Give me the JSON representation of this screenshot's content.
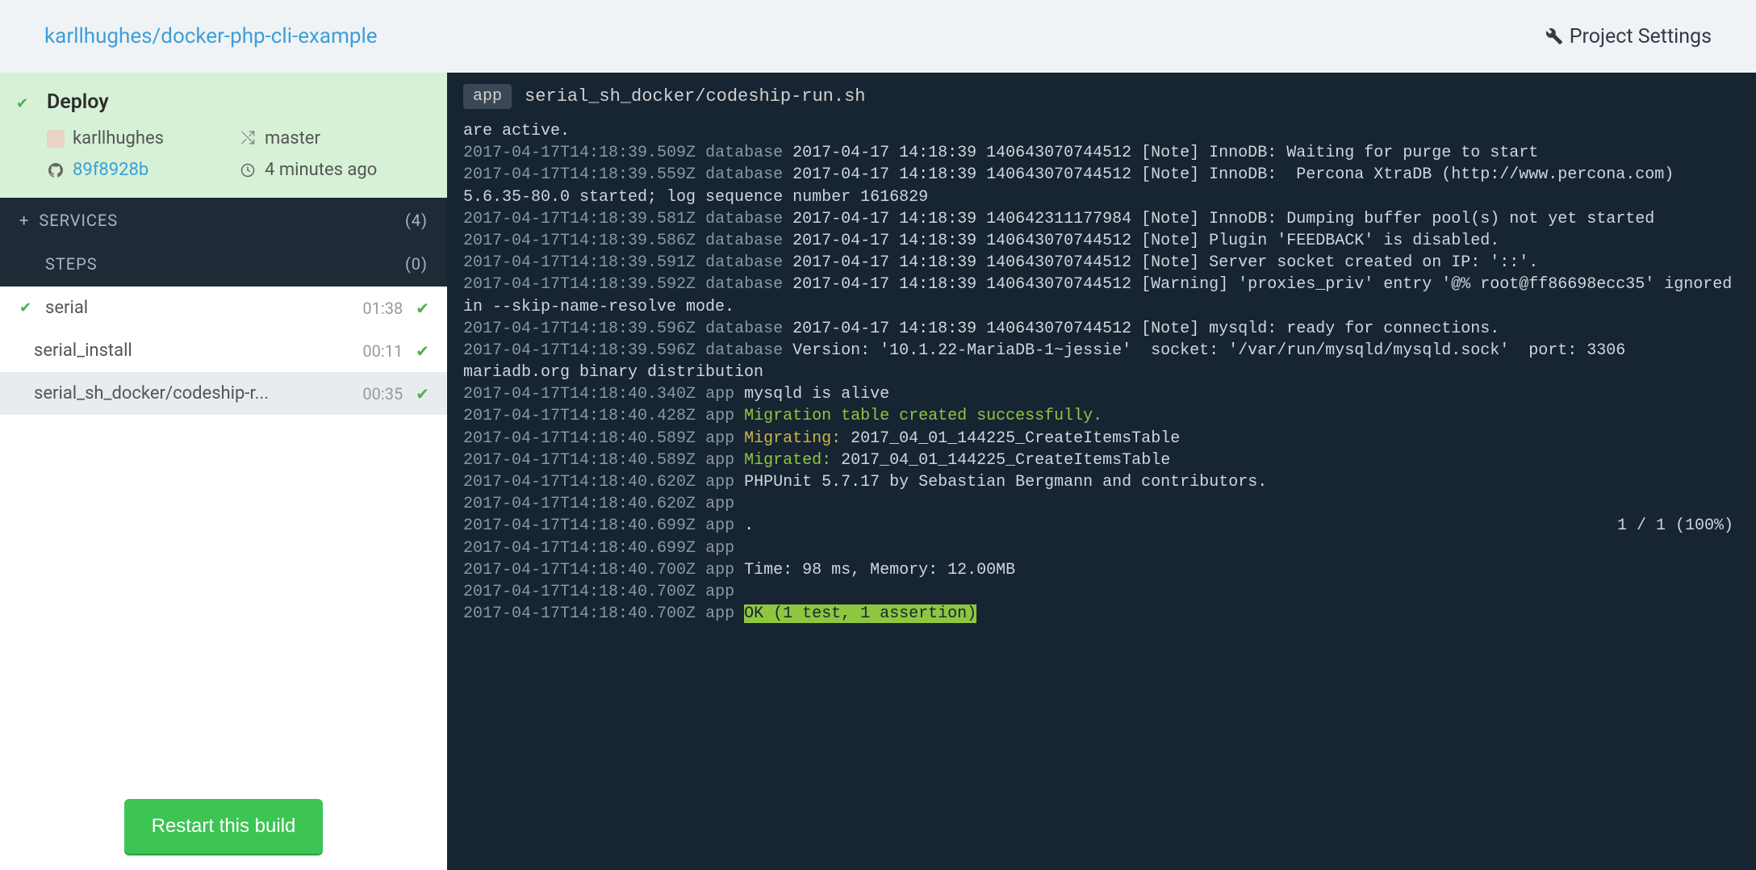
{
  "header": {
    "repo": "karllhughes/docker-php-cli-example",
    "settings": "Project Settings"
  },
  "deploy": {
    "title": "Deploy",
    "user": "karllhughes",
    "branch": "master",
    "commit": "89f8928b",
    "time": "4 minutes ago"
  },
  "services": {
    "label": "SERVICES",
    "count": "(4)"
  },
  "steps": {
    "label": "STEPS",
    "count": "(0)"
  },
  "step_items": [
    {
      "name": "serial",
      "time": "01:38",
      "expanded": true
    },
    {
      "name": "serial_install",
      "time": "00:11"
    },
    {
      "name": "serial_sh_docker/codeship-r...",
      "time": "00:35"
    }
  ],
  "restart_label": "Restart this build",
  "log_header": {
    "badge": "app",
    "path": "serial_sh_docker/codeship-run.sh"
  },
  "progress": "1 / 1 (100%)",
  "log_lines": [
    {
      "ts": "",
      "src": "",
      "plain": "are active."
    },
    {
      "ts": "2017-04-17T14:18:39.509Z",
      "src": "database",
      "txt": "2017-04-17 14:18:39 140643070744512 [Note] InnoDB: Waiting for purge to start"
    },
    {
      "ts": "2017-04-17T14:18:39.559Z",
      "src": "database",
      "txt": "2017-04-17 14:18:39 140643070744512 [Note] InnoDB:  Percona XtraDB (http://www.percona.com) 5.6.35-80.0 started; log sequence number 1616829"
    },
    {
      "ts": "2017-04-17T14:18:39.581Z",
      "src": "database",
      "txt": "2017-04-17 14:18:39 140642311177984 [Note] InnoDB: Dumping buffer pool(s) not yet started"
    },
    {
      "ts": "2017-04-17T14:18:39.586Z",
      "src": "database",
      "txt": "2017-04-17 14:18:39 140643070744512 [Note] Plugin 'FEEDBACK' is disabled."
    },
    {
      "ts": "2017-04-17T14:18:39.591Z",
      "src": "database",
      "txt": "2017-04-17 14:18:39 140643070744512 [Note] Server socket created on IP: '::'."
    },
    {
      "ts": "2017-04-17T14:18:39.592Z",
      "src": "database",
      "txt": "2017-04-17 14:18:39 140643070744512 [Warning] 'proxies_priv' entry '@% root@ff86698ecc35' ignored in --skip-name-resolve mode."
    },
    {
      "ts": "2017-04-17T14:18:39.596Z",
      "src": "database",
      "txt": "2017-04-17 14:18:39 140643070744512 [Note] mysqld: ready for connections."
    },
    {
      "ts": "2017-04-17T14:18:39.596Z",
      "src": "database",
      "txt": "Version: '10.1.22-MariaDB-1~jessie'  socket: '/var/run/mysqld/mysqld.sock'  port: 3306  mariadb.org binary distribution"
    },
    {
      "ts": "2017-04-17T14:18:40.340Z",
      "src": "app",
      "txt": "mysqld is alive"
    },
    {
      "ts": "2017-04-17T14:18:40.428Z",
      "src": "app",
      "green": "Migration table created successfully."
    },
    {
      "ts": "2017-04-17T14:18:40.589Z",
      "src": "app",
      "yellow": "Migrating:",
      "txt": " 2017_04_01_144225_CreateItemsTable"
    },
    {
      "ts": "2017-04-17T14:18:40.589Z",
      "src": "app",
      "green": "Migrated:",
      "txt": " 2017_04_01_144225_CreateItemsTable"
    },
    {
      "ts": "2017-04-17T14:18:40.620Z",
      "src": "app",
      "txt": "PHPUnit 5.7.17 by Sebastian Bergmann and contributors."
    },
    {
      "ts": "2017-04-17T14:18:40.620Z",
      "src": "app",
      "txt": ""
    },
    {
      "ts": "2017-04-17T14:18:40.699Z",
      "src": "app",
      "txt": ".",
      "progress": true
    },
    {
      "ts": "2017-04-17T14:18:40.699Z",
      "src": "app",
      "txt": ""
    },
    {
      "ts": "2017-04-17T14:18:40.700Z",
      "src": "app",
      "txt": "Time: 98 ms, Memory: 12.00MB"
    },
    {
      "ts": "2017-04-17T14:18:40.700Z",
      "src": "app",
      "txt": ""
    },
    {
      "ts": "2017-04-17T14:18:40.700Z",
      "src": "app",
      "ok": "OK (1 test, 1 assertion)"
    }
  ]
}
